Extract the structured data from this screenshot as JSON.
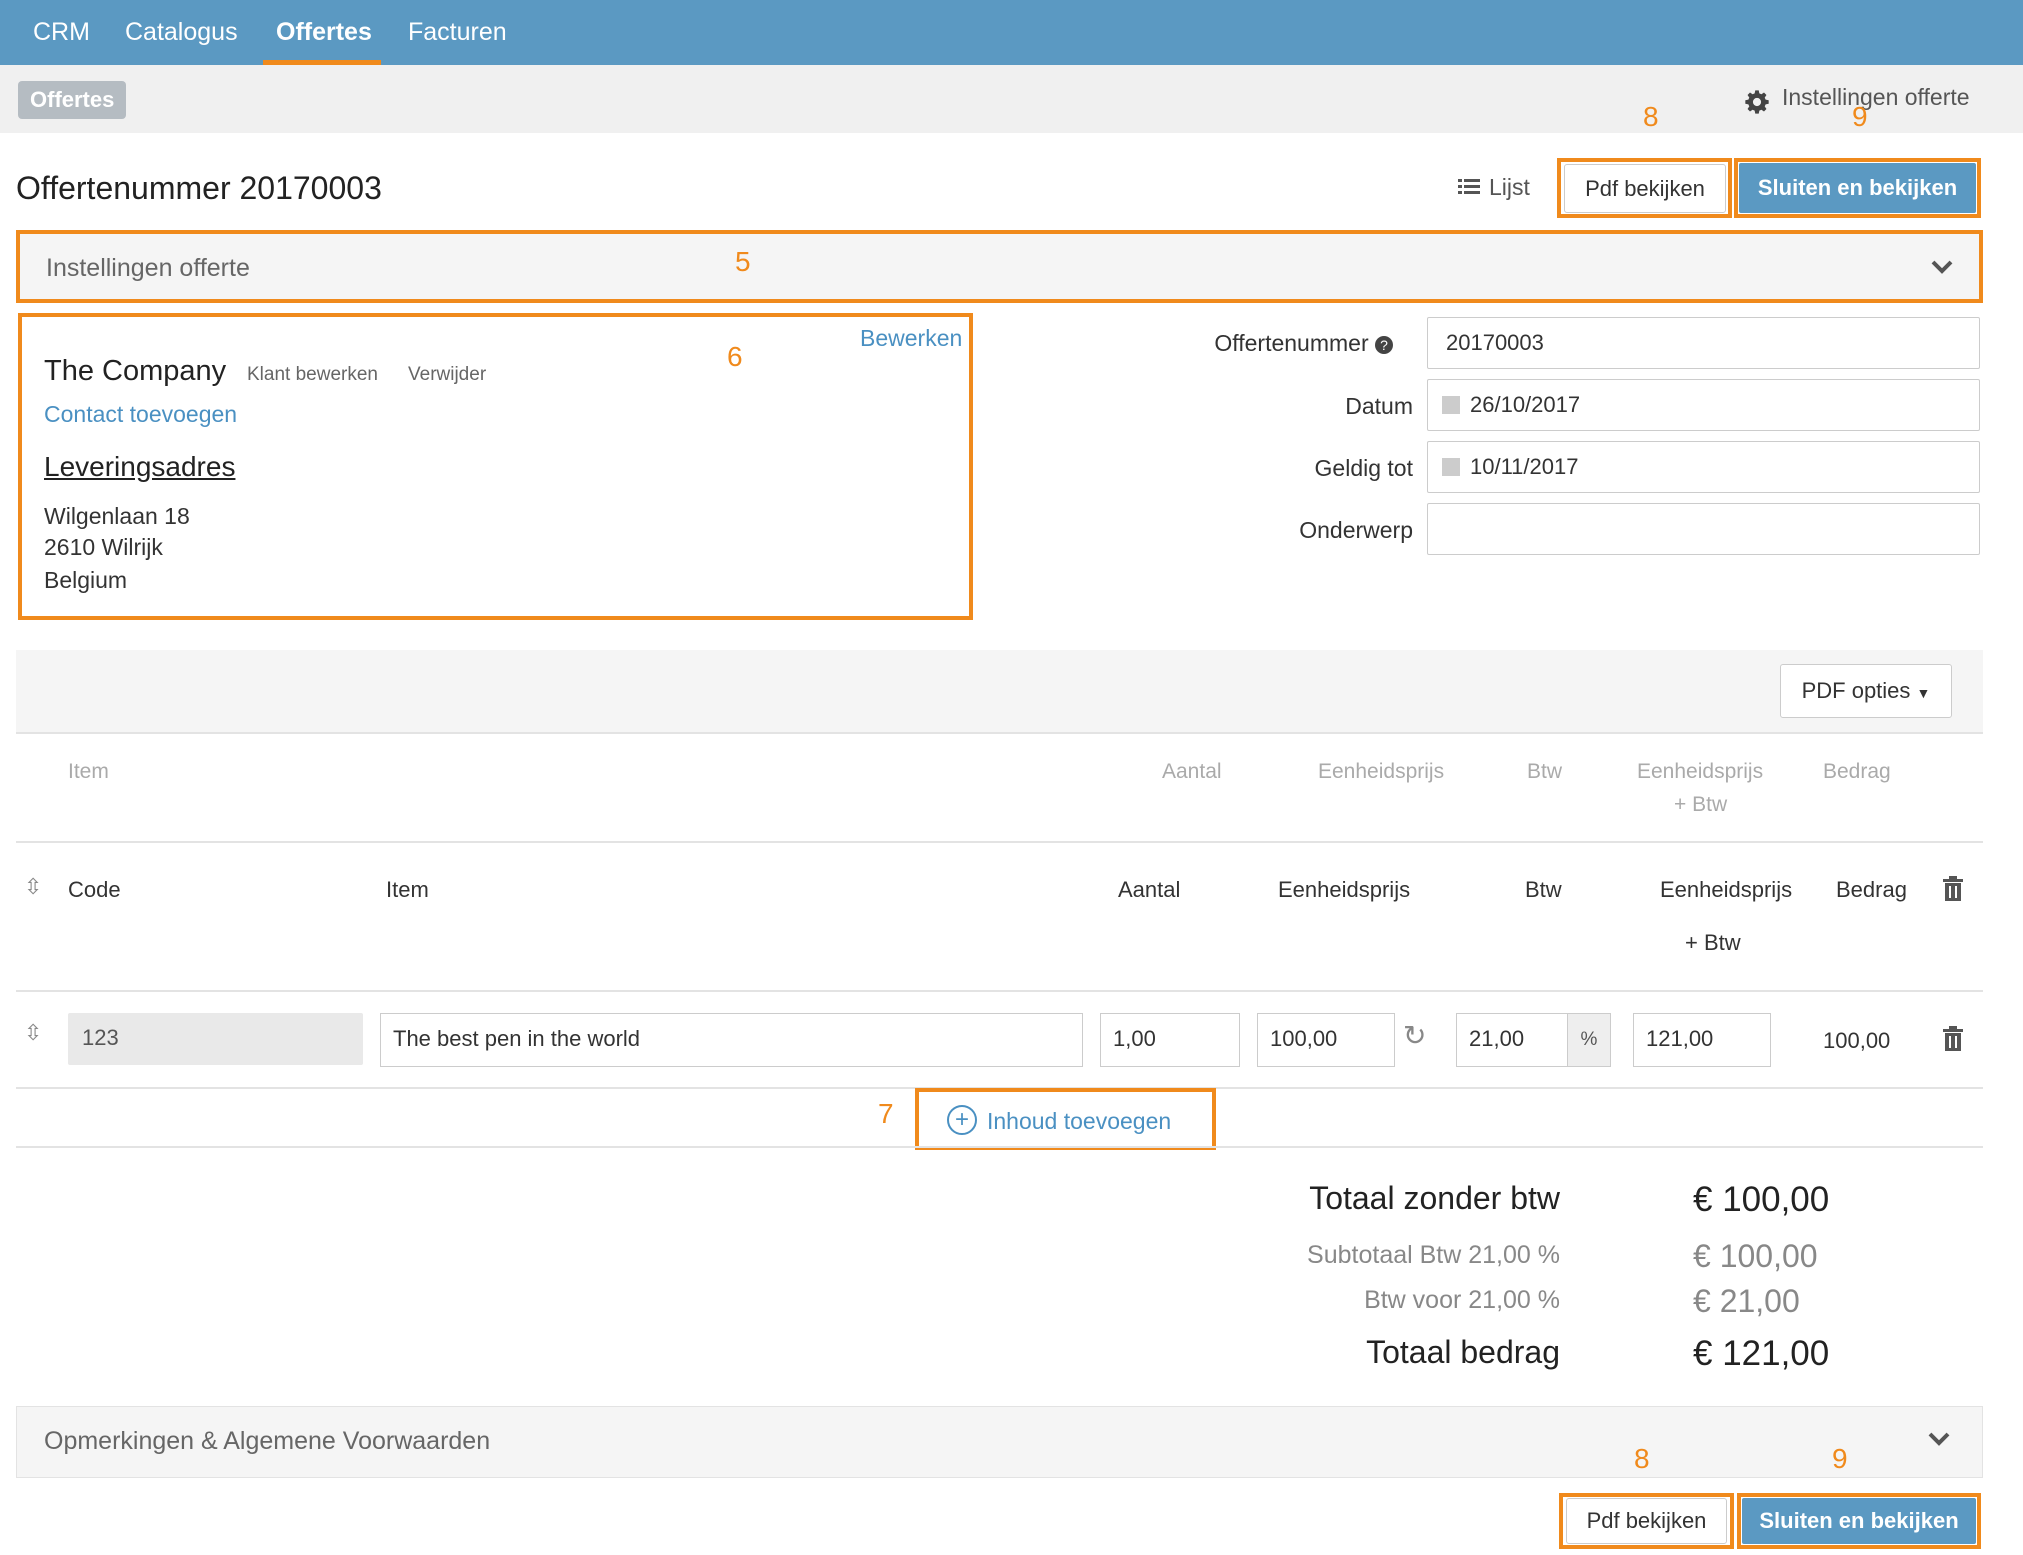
{
  "nav": {
    "items": [
      {
        "label": "CRM"
      },
      {
        "label": "Catalogus"
      },
      {
        "label": "Offertes"
      },
      {
        "label": "Facturen"
      }
    ]
  },
  "subbar": {
    "breadcrumb": "Offertes",
    "settings_link": "Instellingen offerte"
  },
  "annotations": {
    "a5": "5",
    "a6": "6",
    "a7": "7",
    "a8": "8",
    "a9": "9"
  },
  "header": {
    "title": "Offertenummer 20170003",
    "list_label": "Lijst",
    "pdf_button": "Pdf bekijken",
    "close_button": "Sluiten en bekijken"
  },
  "settings_panel": {
    "label": "Instellingen offerte"
  },
  "customer": {
    "edit_link": "Bewerken",
    "name": "The Company",
    "edit_client": "Klant bewerken",
    "remove": "Verwijder",
    "add_contact": "Contact toevoegen",
    "delivery_heading": "Leveringsadres",
    "address_line1": "Wilgenlaan 18",
    "address_line2": "2610 Wilrijk",
    "address_line3": "Belgium"
  },
  "form": {
    "number_label": "Offertenummer",
    "number_value": "20170003",
    "date_label": "Datum",
    "date_value": "26/10/2017",
    "valid_label": "Geldig tot",
    "valid_value": "10/11/2017",
    "subject_label": "Onderwerp",
    "subject_value": ""
  },
  "pdf_options": "PDF opties",
  "columns_light": {
    "item": "Item",
    "qty": "Aantal",
    "unit_price": "Eenheidsprijs",
    "vat": "Btw",
    "unit_price_vat_1": "Eenheidsprijs",
    "unit_price_vat_2": "+ Btw",
    "amount": "Bedrag"
  },
  "columns": {
    "code": "Code",
    "item": "Item",
    "qty": "Aantal",
    "unit_price": "Eenheidsprijs",
    "vat": "Btw",
    "unit_price_vat_1": "Eenheidsprijs",
    "unit_price_vat_2": "+ Btw",
    "amount": "Bedrag"
  },
  "line": {
    "code": "123",
    "item": "The best pen in the world",
    "qty": "1,00",
    "unit_price": "100,00",
    "vat": "21,00",
    "vat_unit": "%",
    "unit_price_vat": "121,00",
    "amount": "100,00"
  },
  "add_content": "Inhoud toevoegen",
  "totals": {
    "net_label": "Totaal zonder btw",
    "net_value": "€ 100,00",
    "subtotal_label": "Subtotaal  Btw 21,00 %",
    "subtotal_value": "€ 100,00",
    "vat_label": "Btw voor 21,00 %",
    "vat_value": "€ 21,00",
    "total_label": "Totaal bedrag",
    "total_value": "€ 121,00"
  },
  "remarks_panel": {
    "label": "Opmerkingen & Algemene Voorwaarden"
  },
  "colors": {
    "nav_blue": "#5b99c2",
    "accent_orange": "#f08a1c",
    "link_blue": "#4a90c2"
  }
}
